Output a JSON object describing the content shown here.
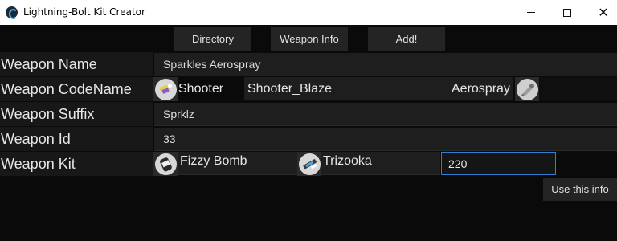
{
  "window": {
    "title": "Lightning-Bolt Kit Creator"
  },
  "toolbar": {
    "directory": "Directory",
    "weapon_info": "Weapon Info",
    "add": "Add!"
  },
  "fields": {
    "weapon_name": {
      "label": "Weapon Name",
      "value": "Sparkles Aerospray"
    },
    "weapon_codename": {
      "label": "Weapon CodeName",
      "class": "Shooter",
      "codename": "Shooter_Blaze",
      "variant": "Aerospray"
    },
    "weapon_suffix": {
      "label": "Weapon Suffix",
      "value": "Sprklz"
    },
    "weapon_id": {
      "label": "Weapon Id",
      "value": "33"
    },
    "weapon_kit": {
      "label": "Weapon Kit",
      "sub_weapon": "Fizzy Bomb",
      "special_weapon": "Trizooka",
      "special_points": "220"
    }
  },
  "actions": {
    "use_this_info": "Use this info"
  },
  "icons": {
    "shooter": "shooter-icon",
    "aerospray": "aerospray-icon",
    "fizzy_bomb": "fizzy-bomb-icon",
    "trizooka": "trizooka-icon"
  },
  "colors": {
    "background": "#0a0a0a",
    "panel": "#1e1e1e",
    "focus_border": "#2f7fd6"
  }
}
